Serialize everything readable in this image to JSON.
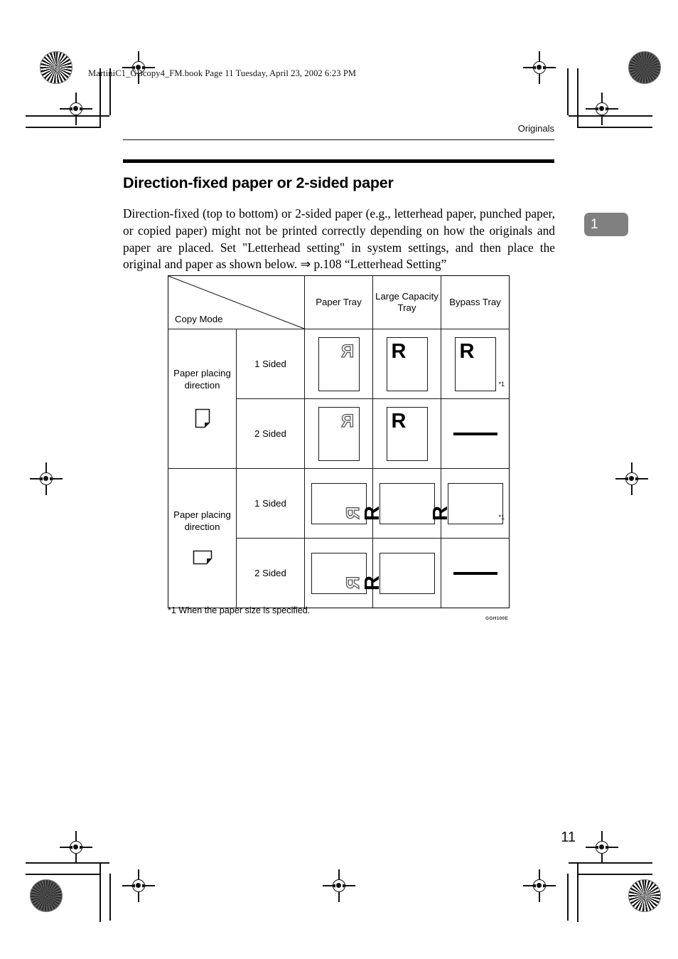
{
  "page": {
    "file_stamp": "MartiniC1_GBcopy4_FM.book  Page 11  Tuesday, April 23, 2002  6:23 PM",
    "running_head": "Originals",
    "chapter_tab": "1",
    "page_number": "11"
  },
  "section": {
    "title": "Direction-fixed paper or 2-sided paper",
    "body": "Direction-fixed (top to bottom) or 2-sided paper (e.g., letterhead paper, punched paper, or copied paper) might not be printed correctly depending on how the originals and paper are placed. Set \"Letterhead setting\" in system settings, and then place the original and paper as shown below. ⇒ p.108 “Letterhead Setting”"
  },
  "figure": {
    "corner_label": "Copy Mode",
    "columns": [
      "Paper Tray",
      "Large Capacity Tray",
      "Bypass Tray"
    ],
    "groups": [
      {
        "orientation_label": "Paper placing direction",
        "orientation_icon": "page-portrait-folded-corner-icon",
        "rows": [
          {
            "mode": "1 Sided",
            "cells": [
              {
                "type": "sheet",
                "shape": "portrait",
                "glyph": "R",
                "style": "mirrored-outline",
                "position": "top-right",
                "footnote": ""
              },
              {
                "type": "sheet",
                "shape": "portrait",
                "glyph": "R",
                "style": "solid",
                "position": "top-left",
                "footnote": ""
              },
              {
                "type": "sheet",
                "shape": "portrait",
                "glyph": "R",
                "style": "solid",
                "position": "top-left",
                "footnote": "*1"
              }
            ]
          },
          {
            "mode": "2 Sided",
            "cells": [
              {
                "type": "sheet",
                "shape": "portrait",
                "glyph": "R",
                "style": "mirrored-outline",
                "position": "top-right",
                "footnote": ""
              },
              {
                "type": "sheet",
                "shape": "portrait",
                "glyph": "R",
                "style": "solid",
                "position": "top-left",
                "footnote": ""
              },
              {
                "type": "dash",
                "shape": "",
                "glyph": "",
                "style": "",
                "position": "",
                "footnote": ""
              }
            ]
          }
        ]
      },
      {
        "orientation_label": "Paper placing direction",
        "orientation_icon": "page-landscape-folded-corner-icon",
        "rows": [
          {
            "mode": "1 Sided",
            "cells": [
              {
                "type": "sheet",
                "shape": "landscape",
                "glyph": "R",
                "style": "mirrored-outline-rotated",
                "position": "bottom-right",
                "footnote": ""
              },
              {
                "type": "sheet",
                "shape": "landscape",
                "glyph": "R",
                "style": "solid-rotated",
                "position": "bottom-left",
                "footnote": ""
              },
              {
                "type": "sheet",
                "shape": "landscape",
                "glyph": "R",
                "style": "solid-rotated",
                "position": "bottom-left",
                "footnote": "*1"
              }
            ]
          },
          {
            "mode": "2 Sided",
            "cells": [
              {
                "type": "sheet",
                "shape": "landscape",
                "glyph": "R",
                "style": "mirrored-outline-rotated",
                "position": "bottom-right",
                "footnote": ""
              },
              {
                "type": "sheet",
                "shape": "landscape",
                "glyph": "R",
                "style": "solid-rotated",
                "position": "bottom-left",
                "footnote": ""
              },
              {
                "type": "dash",
                "shape": "",
                "glyph": "",
                "style": "",
                "position": "",
                "footnote": ""
              }
            ]
          }
        ]
      }
    ],
    "footnote": "*1 When the paper size is specified.",
    "figure_code": "GGH100E"
  },
  "colors": {
    "ink": "#000000",
    "chapter_tab_bg": "#808080",
    "chapter_tab_text": "#ffffff",
    "outline_glyph": "#555555"
  }
}
